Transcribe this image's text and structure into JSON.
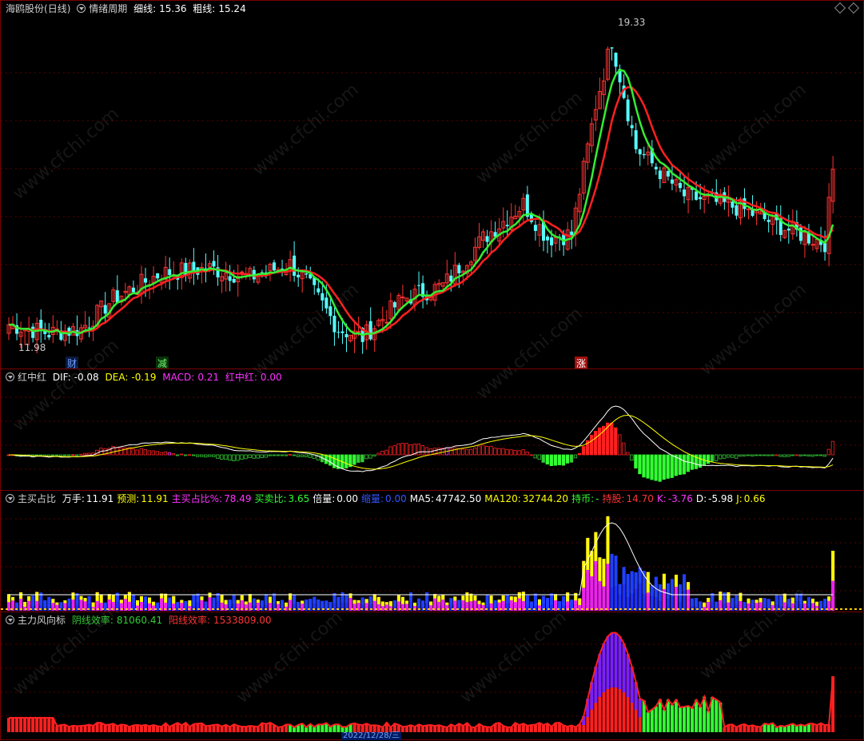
{
  "main": {
    "stock": "海鸥股份",
    "period": "(日线)",
    "indicator": "情绪周期",
    "thin_label": "细线:",
    "thin_value": "15.36",
    "thick_label": "粗线:",
    "thick_value": "15.24",
    "high_label": "19.33",
    "low_label": "11.98",
    "markers": [
      "财",
      "减",
      "涨"
    ]
  },
  "macd": {
    "name": "红中红",
    "dif_label": "DIF:",
    "dif": "-0.08",
    "dea_label": "DEA:",
    "dea": "-0.19",
    "macd_label": "MACD:",
    "macd": "0.21",
    "hzh_label": "红中红:",
    "hzh": "0.00"
  },
  "buy": {
    "name": "主买占比",
    "items": [
      {
        "label": "万手:",
        "value": "11.91",
        "color": "#ffffff"
      },
      {
        "label": "预测:",
        "value": "11.91",
        "color": "#ffff00"
      },
      {
        "label": "主买占比%:",
        "value": "78.49",
        "color": "#ff33ff"
      },
      {
        "label": "买卖比:",
        "value": "3.65",
        "color": "#33ff33"
      },
      {
        "label": "倍量:",
        "value": "0.00",
        "color": "#ffffff"
      },
      {
        "label": "缩量:",
        "value": "0.00",
        "color": "#3355ff"
      },
      {
        "label": "MA5:",
        "value": "47742.50",
        "color": "#ffffff"
      },
      {
        "label": "MA120:",
        "value": "32744.20",
        "color": "#ffff00"
      },
      {
        "label": "持币:",
        "value": "-",
        "color": "#33ff33"
      },
      {
        "label": "持股:",
        "value": "14.70",
        "color": "#ff3333"
      },
      {
        "label": "K:",
        "value": "-3.76",
        "color": "#ff33ff"
      },
      {
        "label": "D:",
        "value": "-5.98",
        "color": "#ffffff"
      },
      {
        "label": "J:",
        "value": "0.66",
        "color": "#ffff00"
      }
    ]
  },
  "flow": {
    "name": "主力风向标",
    "yin_label": "阴线效率:",
    "yin": "81060.41",
    "yang_label": "阳线效率:",
    "yang": "1533809.00"
  },
  "axis": {
    "date_label": "2022/12/28/三"
  },
  "watermark": "www.cfchi.com",
  "colors": {
    "up": "#ff3232",
    "down": "#54ffff",
    "green": "#33ff33",
    "border": "#7a0000"
  }
}
